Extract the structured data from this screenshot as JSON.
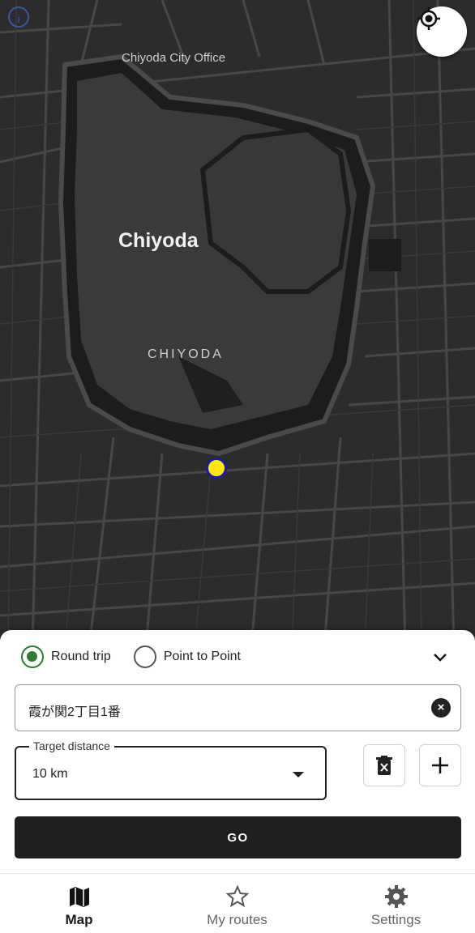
{
  "map": {
    "labels": {
      "office": "Chiyoda City Office",
      "district": "Chiyoda",
      "district_caps": "CHIYODA"
    },
    "icons": {
      "info": "info-icon",
      "locate": "my-location-icon",
      "marker": "start-point-marker"
    },
    "colors": {
      "background": "#2a2a2a",
      "park": "#3b3b3b",
      "road": "#4a4a4a",
      "marker_fill": "#ffeb00",
      "marker_border": "#1a1aa8"
    }
  },
  "route_panel": {
    "trip_modes": [
      {
        "label": "Round trip",
        "selected": true
      },
      {
        "label": "Point to Point",
        "selected": false
      }
    ],
    "collapse_icon": "chevron-down-icon",
    "address": {
      "value": "霞が関2丁目1番",
      "clear_icon": "clear-icon"
    },
    "target_distance": {
      "label": "Target distance",
      "value": "10 km"
    },
    "buttons": {
      "delete_icon": "delete-icon",
      "add_icon": "plus-icon",
      "go": "GO"
    },
    "colors": {
      "accent": "#2e7d32",
      "go_bg": "#1f1f1f"
    }
  },
  "bottom_nav": {
    "items": [
      {
        "label": "Map",
        "icon": "map-icon",
        "active": true
      },
      {
        "label": "My routes",
        "icon": "star-icon",
        "active": false
      },
      {
        "label": "Settings",
        "icon": "gear-icon",
        "active": false
      }
    ]
  }
}
